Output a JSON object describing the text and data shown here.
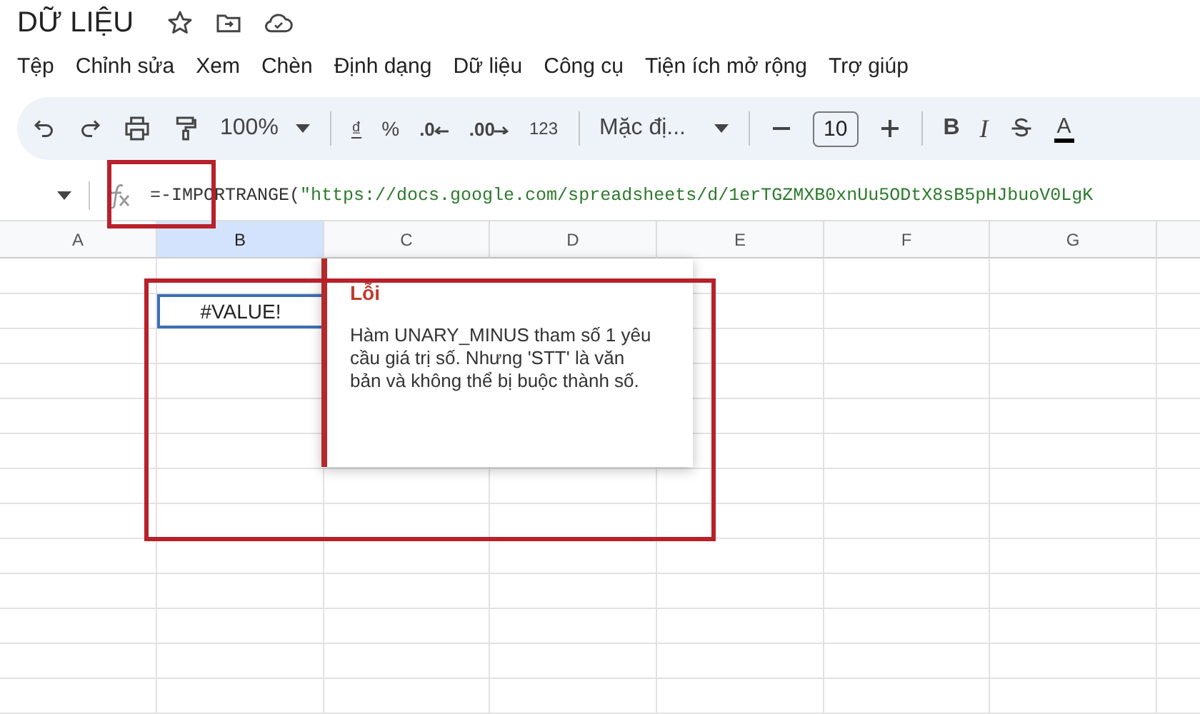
{
  "document": {
    "title": "DỮ LIỆU"
  },
  "menu": [
    "Tệp",
    "Chỉnh sửa",
    "Xem",
    "Chèn",
    "Định dạng",
    "Dữ liệu",
    "Công cụ",
    "Tiện ích mở rộng",
    "Trợ giúp"
  ],
  "toolbar": {
    "zoom": "100%",
    "currency": "₫",
    "percent": "%",
    "decrease_decimals": ".0",
    "increase_decimals": ".00",
    "number_format": "123",
    "font": "Mặc đị...",
    "font_size": "10",
    "bold": "B",
    "italic": "I",
    "text_color": "A"
  },
  "formula_bar": {
    "function": "=-IMPORTRANGE(",
    "argument": "\"https://docs.google.com/spreadsheets/d/1erTGZMXB0xnUu5ODtX8sB5pHJbuoV0LgK"
  },
  "columns": [
    {
      "label": "A",
      "selected": false
    },
    {
      "label": "B",
      "selected": true
    },
    {
      "label": "C",
      "selected": false
    },
    {
      "label": "D",
      "selected": false
    },
    {
      "label": "E",
      "selected": false
    },
    {
      "label": "F",
      "selected": false
    },
    {
      "label": "G",
      "selected": false
    }
  ],
  "active_cell": {
    "value": "#VALUE!",
    "selected": true
  },
  "error_popup": {
    "title": "Lỗi",
    "message": "Hàm UNARY_MINUS tham số 1 yêu cầu giá trị số. Nhưng 'STT' là văn bản và không thể bị buộc thành số."
  }
}
